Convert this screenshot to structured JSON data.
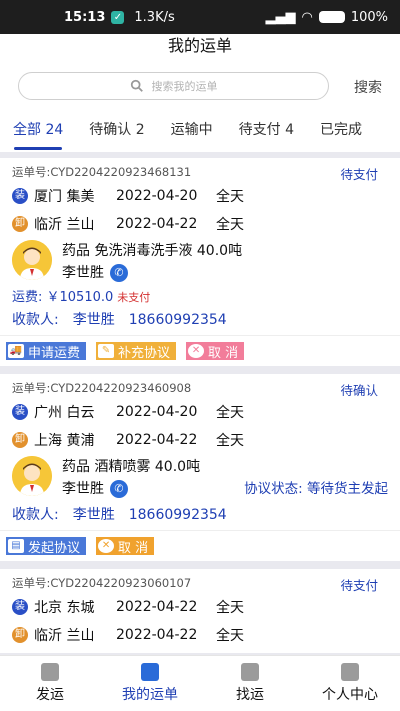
{
  "status_bar": {
    "time": "15:13",
    "speed": "1.3K/s",
    "battery": "100%"
  },
  "header": {
    "title": "我的运单"
  },
  "search": {
    "placeholder": "搜索我的运单",
    "button": "搜索"
  },
  "tabs": [
    {
      "label": "全部 24",
      "active": true
    },
    {
      "label": "待确认 2"
    },
    {
      "label": "运输中"
    },
    {
      "label": "待支付 4"
    },
    {
      "label": "已完成"
    }
  ],
  "orders": [
    {
      "order_no": "运单号:CYD2204220923468131",
      "status": "待支付",
      "load": {
        "badge": "装",
        "city": "厦门 集美",
        "date": "2022-04-20",
        "time": "全天"
      },
      "unload": {
        "badge": "卸",
        "city": "临沂 兰山",
        "date": "2022-04-22",
        "time": "全天"
      },
      "goods": "药品  免洗消毒洗手液 40.0吨",
      "driver": "李世胜",
      "freight_label": "运费: ￥10510.0",
      "freight_status": "未支付",
      "receiver_label": "收款人:",
      "receiver_name": "李世胜",
      "receiver_phone": "18660992354",
      "actions": [
        "申请运费",
        "补充协议",
        "取  消"
      ]
    },
    {
      "order_no": "运单号:CYD2204220923460908",
      "status": "待确认",
      "load": {
        "badge": "装",
        "city": "广州 白云",
        "date": "2022-04-20",
        "time": "全天"
      },
      "unload": {
        "badge": "卸",
        "city": "上海 黄浦",
        "date": "2022-04-22",
        "time": "全天"
      },
      "goods": "药品  酒精喷雾 40.0吨",
      "driver": "李世胜",
      "protocol_status": "协议状态: 等待货主发起",
      "receiver_label": "收款人:",
      "receiver_name": "李世胜",
      "receiver_phone": "18660992354",
      "actions": [
        "发起协议",
        "取  消"
      ]
    },
    {
      "order_no": "运单号:CYD2204220923060107",
      "status": "待支付",
      "load": {
        "badge": "装",
        "city": "北京 东城",
        "date": "2022-04-22",
        "time": "全天"
      },
      "unload": {
        "badge": "卸",
        "city": "临沂 兰山",
        "date": "2022-04-22",
        "time": "全天"
      }
    }
  ],
  "bottom_nav": [
    {
      "label": "发运",
      "icon": "box-icon"
    },
    {
      "label": "我的运单",
      "icon": "document-icon",
      "active": true
    },
    {
      "label": "找运",
      "icon": "truck-icon"
    },
    {
      "label": "个人中心",
      "icon": "user-icon"
    }
  ],
  "colors": {
    "accent": "#1f3fb3",
    "load_badge": "#2a4fc6",
    "unload_badge": "#e2912d",
    "unpaid": "#d43030"
  }
}
